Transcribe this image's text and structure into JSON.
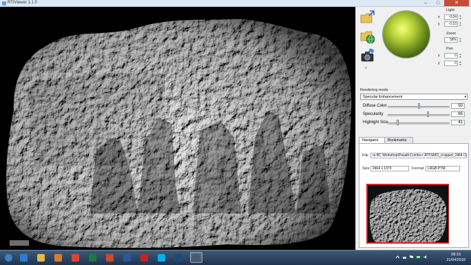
{
  "window": {
    "title": "RTIViewer 1.1.0",
    "minimize": "–",
    "maximize": "□",
    "close": "✕"
  },
  "toolbar": {
    "buttons": [
      {
        "name": "open-file-button",
        "icon": "folder-arrow-icon"
      },
      {
        "name": "open-remote-button",
        "icon": "folder-globe-icon"
      },
      {
        "name": "snapshot-button",
        "icon": "camera-icon"
      }
    ],
    "small_arrow": "»"
  },
  "light": {
    "label": "Light",
    "x_label": "x",
    "x_value": "-0.04",
    "y_label": "y",
    "y_value": "-0.10"
  },
  "zoom": {
    "label": "Zoom",
    "value": "58%"
  },
  "pan": {
    "label": "Pan",
    "x_label": "x",
    "x_value": "0",
    "y_label": "y",
    "y_value": "0"
  },
  "rendering": {
    "label": "Rendering mode",
    "selected": "Specular Enhancement"
  },
  "params": [
    {
      "label": "Diffuse Color",
      "value": "50",
      "level": 0.5
    },
    {
      "label": "Specularity",
      "value": "65",
      "level": 0.65
    },
    {
      "label": "Highlight Size",
      "value": "41",
      "level": 0.15
    }
  ],
  "tabs": {
    "navigator": "Navigator",
    "bookmarks": "Bookmarks"
  },
  "navigator": {
    "file_label": "File",
    "file_value": "ra BC Workshop\\Pasalli-Combo-r-RTI\\SMD_cropped_2464 (1).ptm",
    "size_label": "Size",
    "size_value": "2464 x 1373",
    "format_label": "Format",
    "format_value": "LRGB PTM"
  },
  "taskbar": {
    "apps": [
      {
        "name": "start-button",
        "icon": "windows-orb-icon",
        "color": "#3b82c4"
      },
      {
        "name": "ie-taskbar-button",
        "icon": "internet-explorer-icon",
        "color": "#2a7fd4"
      },
      {
        "name": "explorer-taskbar-button",
        "icon": "folder-icon",
        "color": "#e8b84a"
      },
      {
        "name": "media-player-taskbar-button",
        "icon": "media-player-icon",
        "color": "#e07a20"
      },
      {
        "name": "chrome-taskbar-button",
        "icon": "chrome-icon",
        "color": "#dd4433"
      },
      {
        "name": "excel-taskbar-button",
        "icon": "excel-icon",
        "color": "#1f7a3f"
      },
      {
        "name": "powerpoint-taskbar-button",
        "icon": "powerpoint-icon",
        "color": "#d24726"
      },
      {
        "name": "word-taskbar-button",
        "icon": "word-icon",
        "color": "#2b579a"
      },
      {
        "name": "acrobat-taskbar-button",
        "icon": "acrobat-icon",
        "color": "#c8201e"
      },
      {
        "name": "skype-taskbar-button",
        "icon": "skype-icon",
        "color": "#00aff0"
      },
      {
        "name": "photoshop-taskbar-button",
        "icon": "photoshop-icon",
        "color": "#1a4a7a"
      },
      {
        "name": "rtiviewer-taskbar-button",
        "icon": "rtiviewer-icon",
        "color": "#4a5a70"
      }
    ],
    "time": "08:15",
    "date": "21/04/2018"
  }
}
